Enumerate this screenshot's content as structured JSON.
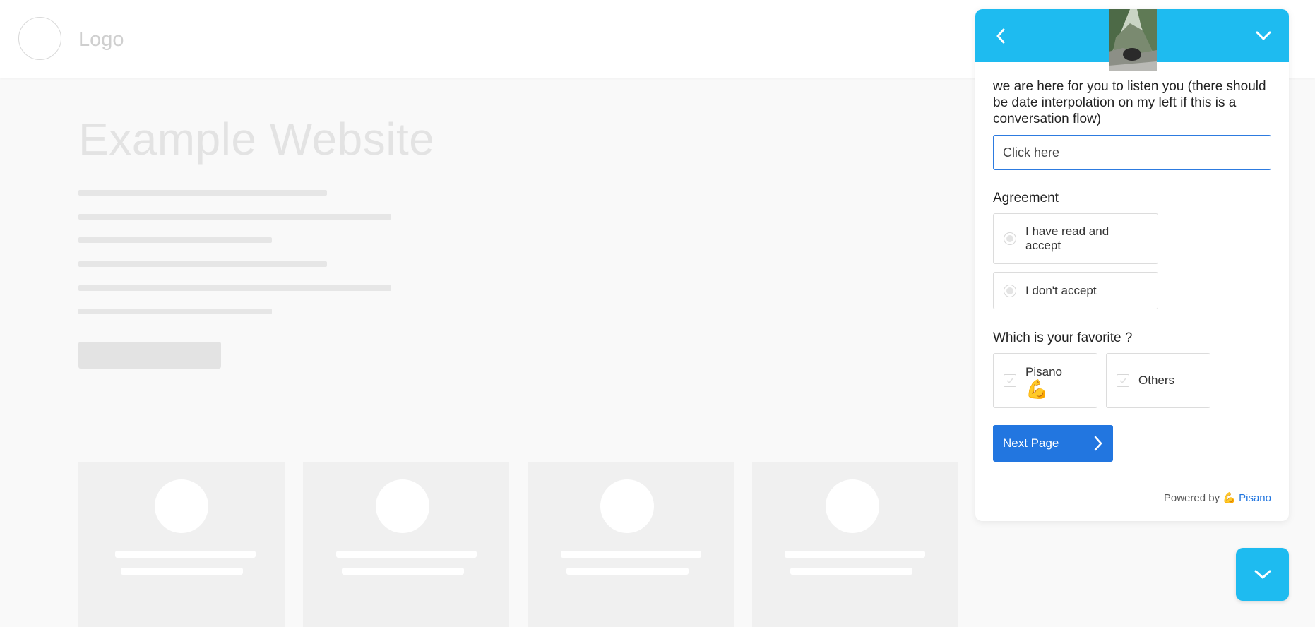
{
  "site": {
    "logo_text": "Logo",
    "title": "Example Website"
  },
  "widget": {
    "question_text": "we are here for you to listen you (there should be date interpolation on my left if this is a conversation flow)",
    "input_placeholder": "Click here",
    "agreement": {
      "label": "Agreement",
      "options": [
        "I have read and accept",
        "I don't accept"
      ]
    },
    "favorite": {
      "label": "Which is your favorite ?",
      "options": [
        "Pisano",
        "Others"
      ],
      "pisano_emoji": "💪"
    },
    "next_button": "Next Page",
    "powered_by": "Powered by",
    "powered_emoji": "💪",
    "powered_brand": "Pisano"
  },
  "colors": {
    "header": "#1ebbf0",
    "primary": "#2276e0"
  },
  "icons": {
    "back": "chevron-left-icon",
    "minimize": "chevron-down-icon",
    "fab": "chevron-down-icon"
  }
}
